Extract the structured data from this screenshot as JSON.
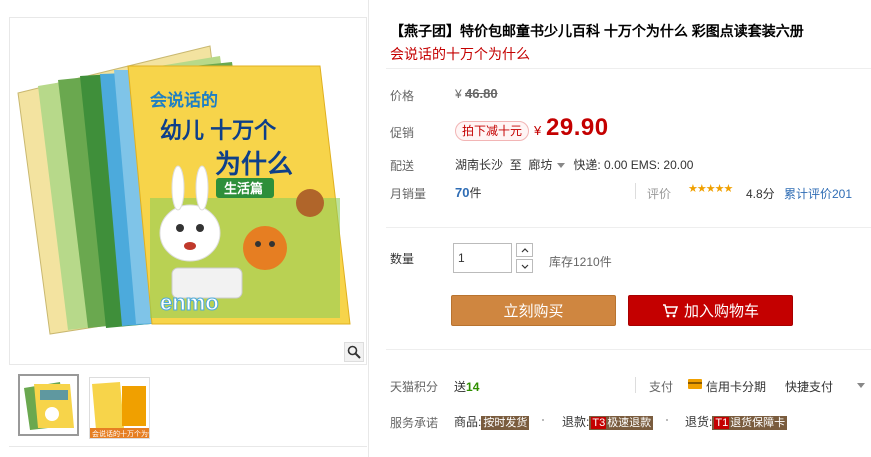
{
  "product": {
    "title": "【燕子团】特价包邮童书少儿百科 十万个为什么 彩图点读套装六册",
    "subtitle": "会说话的十万个为什么"
  },
  "cover": {
    "headline_small": "会说话的",
    "headline_large_1": "幼儿 十万个",
    "headline_large_2": "为什么",
    "volume": "生活篇",
    "logo": "enmo"
  },
  "thumbs": {
    "second_label": "会说话的十万个为什么"
  },
  "price": {
    "label": "价格",
    "currency": "¥",
    "original": "46.80"
  },
  "promo": {
    "label": "促销",
    "tag": "拍下减十元",
    "currency": "¥",
    "price": "29.90"
  },
  "shipping": {
    "label": "配送",
    "from": "湖南长沙",
    "to_word": "至",
    "to": "廊坊",
    "fees": "快递: 0.00 EMS: 20.00"
  },
  "sales": {
    "label": "月销量",
    "count": "70",
    "unit": "件",
    "review_label": "评价",
    "stars": "★★★★★",
    "rating": 4.8,
    "rating_text": "4.8分",
    "review_count_text": "累计评价201"
  },
  "quantity": {
    "label": "数量",
    "value": "1",
    "stock": "库存1210件"
  },
  "buttons": {
    "buy": "立刻购买",
    "cart": "加入购物车"
  },
  "points": {
    "label": "天猫积分",
    "prefix": "送",
    "value": "14"
  },
  "payment": {
    "label": "支付",
    "card": "信用卡分期",
    "fast": "快捷支付"
  },
  "service": {
    "label": "服务承诺",
    "goods_label": "商品:",
    "goods_tag": "按时发货",
    "refund_label": "退款:",
    "refund_prefix": "T3",
    "refund_tag": "极速退款",
    "return_label": "退货:",
    "return_prefix": "T1",
    "return_tag": "退货保障卡"
  },
  "colors": {
    "price_red": "#c40000",
    "buy_orange": "#cf8640",
    "link_blue": "#2f6db5"
  }
}
